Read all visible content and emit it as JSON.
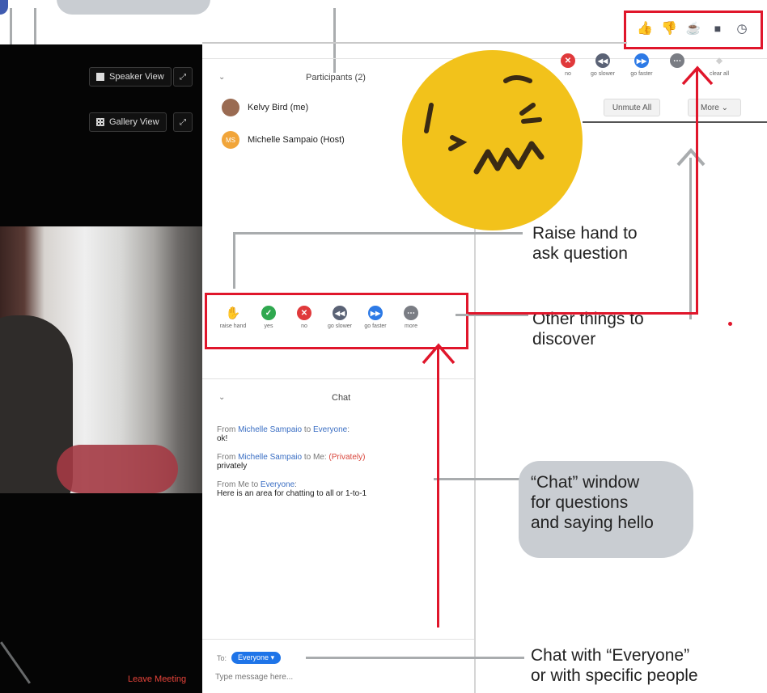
{
  "video": {
    "speaker_view_label": "Speaker View",
    "gallery_view_label": "Gallery View",
    "leave_label": "Leave Meeting"
  },
  "participants": {
    "title": "Participants (2)",
    "list": [
      {
        "name": "Kelvy Bird (me)",
        "avatar_color": "#9a6b52"
      },
      {
        "name": "Michelle Sampaio (Host)",
        "avatar_color": "#f1a53a",
        "initials": "MS"
      }
    ],
    "reactions": [
      {
        "label": "raise hand",
        "icon": "raise-hand-icon",
        "color": "#3f7be0"
      },
      {
        "label": "yes",
        "icon": "check-icon",
        "color": "#2fa84f"
      },
      {
        "label": "no",
        "icon": "x-icon",
        "color": "#e0393b"
      },
      {
        "label": "go slower",
        "icon": "rewind-icon",
        "color": "#5a6275"
      },
      {
        "label": "go faster",
        "icon": "fast-forward-icon",
        "color": "#2d7ae6"
      },
      {
        "label": "more",
        "icon": "more-icon",
        "color": "#7a7d84"
      }
    ]
  },
  "second_panel": {
    "reactions": [
      {
        "label": "no",
        "color": "#e0393b"
      },
      {
        "label": "go slower",
        "color": "#5a6275"
      },
      {
        "label": "go faster",
        "color": "#2d7ae6"
      },
      {
        "label": "",
        "color": "#7a7d84"
      },
      {
        "label": "clear all",
        "color": "#cfcfcf"
      }
    ],
    "unmute_all_label": "Unmute All",
    "more_label": "More ⌄"
  },
  "toolbar_icons": [
    "thumbs-up-icon",
    "thumbs-down-icon",
    "coffee-icon",
    "speech-bubble-icon",
    "clock-icon"
  ],
  "chat": {
    "title": "Chat",
    "messages": [
      {
        "from_prefix": "From ",
        "sender": "Michelle Sampaio",
        "to_prefix": " to ",
        "recipient": "Everyone",
        "private_tag": "",
        "text": "ok!"
      },
      {
        "from_prefix": "From ",
        "sender": "Michelle Sampaio",
        "to_prefix": " to ",
        "recipient": "Me",
        "private_tag": "(Privately)",
        "text": "privately"
      },
      {
        "from_prefix": "From ",
        "sender": "Me",
        "to_prefix": " to ",
        "recipient": "Everyone",
        "private_tag": "",
        "text": "Here is an area for chatting to all or 1-to-1"
      }
    ],
    "to_label": "To:",
    "recipient_value": "Everyone",
    "input_placeholder": "Type message here..."
  },
  "annotations": {
    "raise_hand": [
      "Raise hand to",
      "ask question"
    ],
    "other": [
      "Other things to",
      "discover"
    ],
    "chat_window": [
      "“Chat” window",
      "for questions",
      "and saying hello"
    ],
    "chat_everyone": [
      "Chat with “Everyone”",
      "or with specific people"
    ]
  },
  "colors": {
    "highlight_red": "#e0162b",
    "callout_grey": "#c9cdd2",
    "emoji_yellow": "#f2c21b",
    "link_blue": "#3a6ec3"
  }
}
